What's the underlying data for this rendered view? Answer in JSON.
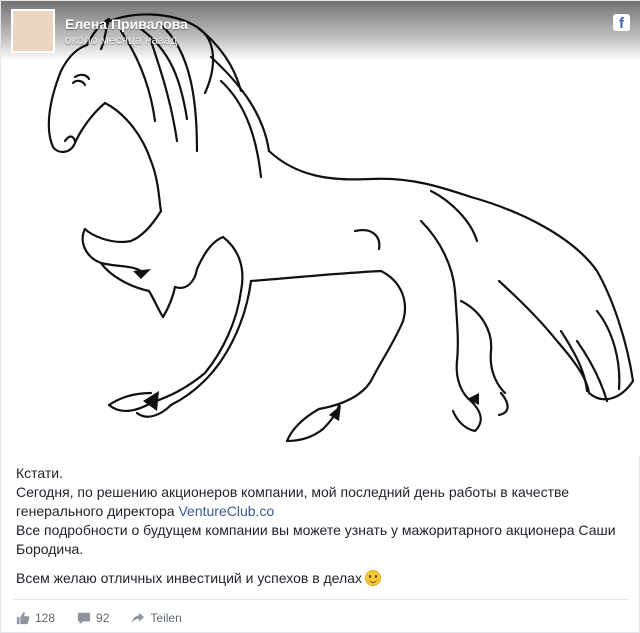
{
  "post": {
    "author": "Елена Привалова",
    "timestamp": "около месяца назад",
    "badge_icon": "facebook-icon"
  },
  "body": {
    "line1": "Кстати.",
    "line2_prefix": "Сегодня, по решению акционеров компании, мой последний день работы в качестве генерального директора ",
    "link": "VentureClub.co",
    "line3": "Все подробности о будущем компании вы можете узнать у мажоритарного акционера Саши Бородича.",
    "line4": "Всем желаю отличных инвестиций и успехов в делах",
    "emoji": "smiley-icon"
  },
  "footer": {
    "likes": "128",
    "comments": "92",
    "share_label": "Teilen"
  },
  "colors": {
    "link": "#365899",
    "text": "#1d2129",
    "meta": "#616770",
    "facebook_blue": "#4267b2"
  }
}
